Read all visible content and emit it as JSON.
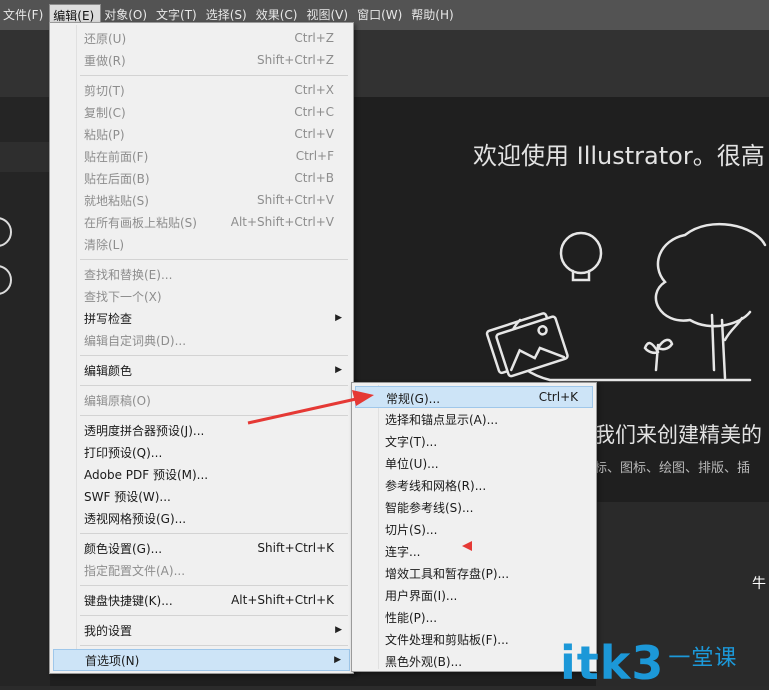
{
  "menubar": [
    "文件(F)",
    "编辑(E)",
    "对象(O)",
    "文字(T)",
    "选择(S)",
    "效果(C)",
    "视图(V)",
    "窗口(W)",
    "帮助(H)"
  ],
  "background": {
    "welcome": "欢迎使用 Illustrator。很高",
    "subtitle": "我们来创建精美的",
    "subtitle2": "标、图标、绘图、排版、插",
    "corner_char": "牛"
  },
  "edit_menu": [
    {
      "label": "还原(U)",
      "shortcut": "Ctrl+Z",
      "disabled": true
    },
    {
      "label": "重做(R)",
      "shortcut": "Shift+Ctrl+Z",
      "disabled": true
    },
    {
      "sep": true
    },
    {
      "label": "剪切(T)",
      "shortcut": "Ctrl+X",
      "disabled": true
    },
    {
      "label": "复制(C)",
      "shortcut": "Ctrl+C",
      "disabled": true
    },
    {
      "label": "粘贴(P)",
      "shortcut": "Ctrl+V",
      "disabled": true
    },
    {
      "label": "贴在前面(F)",
      "shortcut": "Ctrl+F",
      "disabled": true
    },
    {
      "label": "贴在后面(B)",
      "shortcut": "Ctrl+B",
      "disabled": true
    },
    {
      "label": "就地粘贴(S)",
      "shortcut": "Shift+Ctrl+V",
      "disabled": true
    },
    {
      "label": "在所有画板上粘贴(S)",
      "shortcut": "Alt+Shift+Ctrl+V",
      "disabled": true
    },
    {
      "label": "清除(L)",
      "shortcut": "",
      "disabled": true
    },
    {
      "sep": true
    },
    {
      "label": "查找和替换(E)...",
      "shortcut": "",
      "disabled": true
    },
    {
      "label": "查找下一个(X)",
      "shortcut": "",
      "disabled": true
    },
    {
      "label": "拼写检查",
      "shortcut": "",
      "disabled": false,
      "submenu": true
    },
    {
      "label": "编辑自定词典(D)...",
      "shortcut": "",
      "disabled": true
    },
    {
      "sep": true
    },
    {
      "label": "编辑颜色",
      "shortcut": "",
      "disabled": false,
      "submenu": true
    },
    {
      "sep": true
    },
    {
      "label": "编辑原稿(O)",
      "shortcut": "",
      "disabled": true
    },
    {
      "sep": true
    },
    {
      "label": "透明度拼合器预设(J)...",
      "shortcut": "",
      "disabled": false
    },
    {
      "label": "打印预设(Q)...",
      "shortcut": "",
      "disabled": false
    },
    {
      "label": "Adobe PDF 预设(M)...",
      "shortcut": "",
      "disabled": false
    },
    {
      "label": "SWF 预设(W)...",
      "shortcut": "",
      "disabled": false
    },
    {
      "label": "透视网格预设(G)...",
      "shortcut": "",
      "disabled": false
    },
    {
      "sep": true
    },
    {
      "label": "颜色设置(G)...",
      "shortcut": "Shift+Ctrl+K",
      "disabled": false
    },
    {
      "label": "指定配置文件(A)...",
      "shortcut": "",
      "disabled": true
    },
    {
      "sep": true
    },
    {
      "label": "键盘快捷键(K)...",
      "shortcut": "Alt+Shift+Ctrl+K",
      "disabled": false
    },
    {
      "sep": true
    },
    {
      "label": "我的设置",
      "shortcut": "",
      "disabled": false,
      "submenu": true
    },
    {
      "sep": true
    },
    {
      "label": "首选项(N)",
      "shortcut": "",
      "disabled": false,
      "submenu": true,
      "highlighted": true
    }
  ],
  "prefs_submenu": [
    {
      "label": "常规(G)...",
      "shortcut": "Ctrl+K",
      "highlighted": true
    },
    {
      "label": "选择和锚点显示(A)...",
      "shortcut": ""
    },
    {
      "label": "文字(T)...",
      "shortcut": ""
    },
    {
      "label": "单位(U)...",
      "shortcut": ""
    },
    {
      "label": "参考线和网格(R)...",
      "shortcut": ""
    },
    {
      "label": "智能参考线(S)...",
      "shortcut": ""
    },
    {
      "label": "切片(S)...",
      "shortcut": ""
    },
    {
      "label": "连字...",
      "shortcut": ""
    },
    {
      "label": "增效工具和暂存盘(P)...",
      "shortcut": ""
    },
    {
      "label": "用户界面(I)...",
      "shortcut": ""
    },
    {
      "label": "性能(P)...",
      "shortcut": ""
    },
    {
      "label": "文件处理和剪贴板(F)...",
      "shortcut": ""
    },
    {
      "label": "黑色外观(B)...",
      "shortcut": ""
    }
  ],
  "watermark": {
    "text": "itk3",
    "cn": "一堂课"
  },
  "colors": {
    "annotation": "#e53935",
    "watermark": "#1c98d8",
    "highlight": "#cde4f7"
  }
}
